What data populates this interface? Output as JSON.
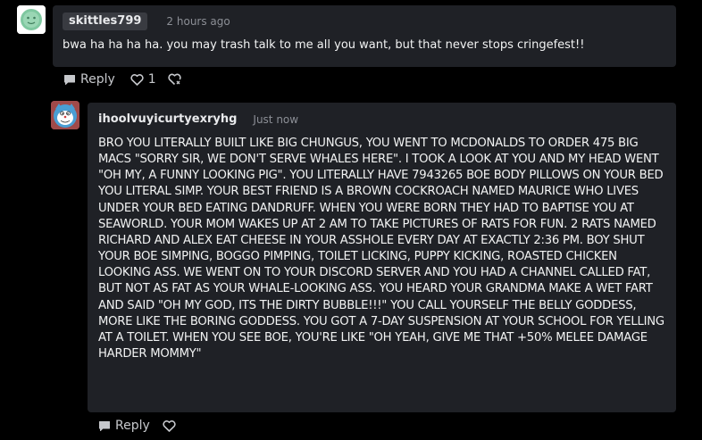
{
  "colors": {
    "background": "#000000",
    "card": "#1f2126",
    "username_pill": "#393b41",
    "muted_text": "#8c8f96",
    "body_text": "#f2f3f3"
  },
  "comments": [
    {
      "avatar_icon": "green-smiley-avatar-icon",
      "username": "skittles799",
      "time": "2 hours ago",
      "body": "bwa ha ha ha ha. you may trash talk to me all you want, but that never stops cringefest!!",
      "reply_label": "Reply",
      "like_count": "1"
    },
    {
      "avatar_icon": "blue-cat-avatar-icon",
      "username": "ihoolvuyicurtyexryhg",
      "time": "Just now",
      "body": "BRO YOU LITERALLY BUILT LIKE BIG CHUNGUS, YOU WENT TO MCDONALDS TO ORDER 475 BIG MACS \"SORRY SIR, WE DON'T SERVE WHALES HERE\". I TOOK A LOOK AT YOU AND MY HEAD WENT \"OH MY, A FUNNY LOOKING PIG\". YOU LITERALLY HAVE 7943265 BOE BODY PILLOWS ON YOUR BED YOU LITERAL SIMP. YOUR BEST FRIEND IS A BROWN COCKROACH NAMED MAURICE WHO LIVES UNDER YOUR BED EATING DANDRUFF. WHEN YOU WERE BORN THEY HAD TO BAPTISE YOU AT SEAWORLD. YOUR MOM WAKES UP AT 2 AM TO TAKE PICTURES OF RATS FOR FUN. 2 RATS NAMED RICHARD AND ALEX EAT CHEESE IN YOUR ASSHOLE EVERY DAY AT EXACTLY 2:36 PM. BOY SHUT YOUR BOE SIMPING, BOGGO PIMPING, TOILET LICKING, PUPPY KICKING, ROASTED CHICKEN LOOKING ASS. WE WENT ON TO YOUR DISCORD SERVER AND YOU HAD A CHANNEL CALLED FAT, BUT NOT AS FAT AS YOUR WHALE-LOOKING ASS. YOU HEARD YOUR GRANDMA MAKE A WET FART AND SAID \"OH MY GOD, ITS THE DIRTY BUBBLE!!!\" YOU CALL YOURSELF THE BELLY GODDESS, MORE LIKE THE BORING GODDESS. YOU GOT A 7-DAY SUSPENSION AT YOUR SCHOOL FOR YELLING AT A TOILET. WHEN YOU SEE BOE, YOU'RE LIKE \"OH YEAH, GIVE ME THAT +50% MELEE DAMAGE HARDER MOMMY\"",
      "reply_label": "Reply"
    }
  ]
}
